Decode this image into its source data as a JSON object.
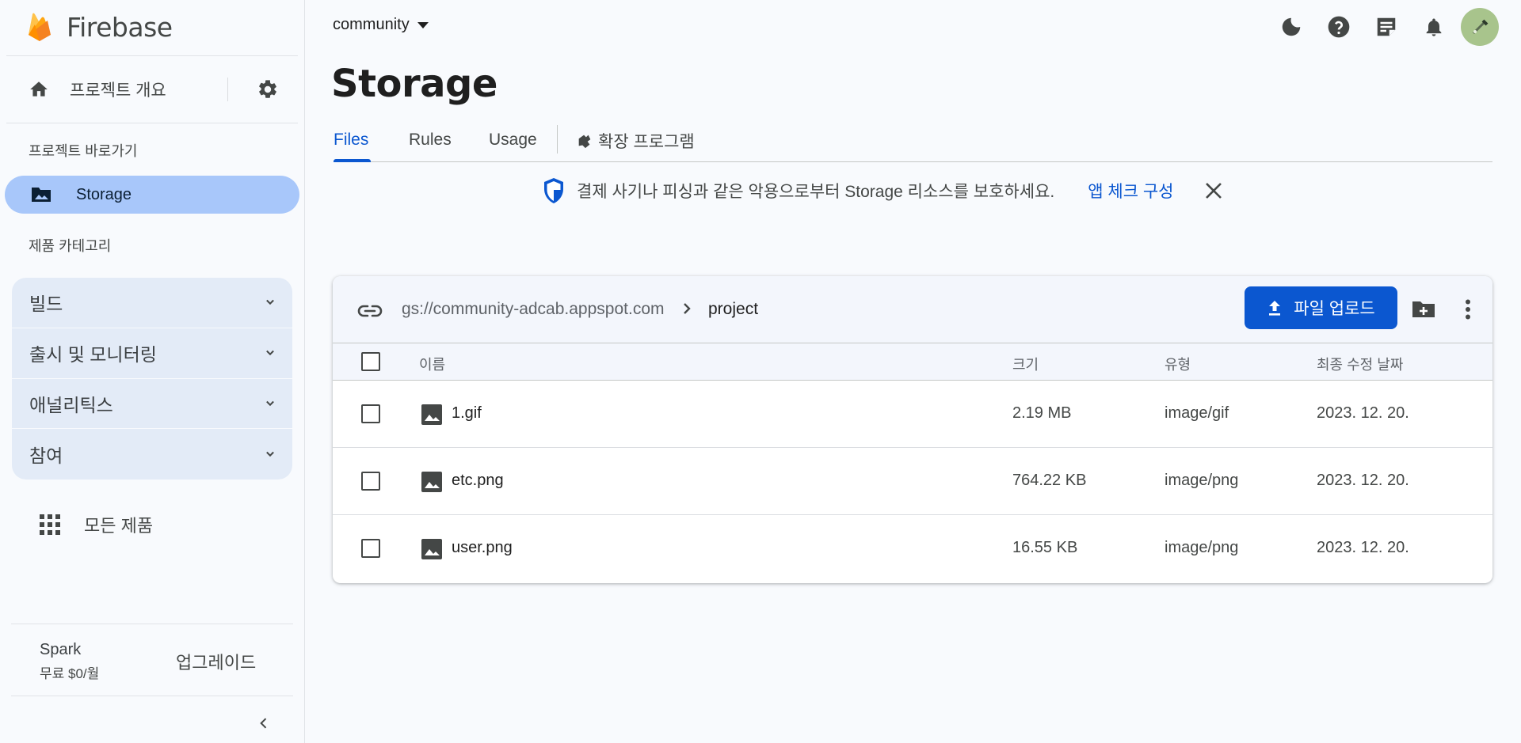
{
  "app": {
    "brand": "Firebase"
  },
  "sidebar": {
    "overview_label": "프로젝트 개요",
    "shortcuts_heading": "프로젝트 바로가기",
    "storage_label": "Storage",
    "categories_heading": "제품 카테고리",
    "categories": [
      {
        "label": "빌드"
      },
      {
        "label": "출시 및 모니터링"
      },
      {
        "label": "애널리틱스"
      },
      {
        "label": "참여"
      }
    ],
    "all_products_label": "모든 제품",
    "plan": {
      "name": "Spark",
      "price": "무료 $0/월",
      "upgrade_label": "업그레이드"
    }
  },
  "header": {
    "project_name": "community"
  },
  "page": {
    "title": "Storage",
    "tabs": [
      {
        "label": "Files",
        "active": true
      },
      {
        "label": "Rules",
        "active": false
      },
      {
        "label": "Usage",
        "active": false
      },
      {
        "label": "확장 프로그램",
        "active": false
      }
    ],
    "banner": {
      "text": "결제 사기나 피싱과 같은 악용으로부터 Storage 리소스를 보호하세요.",
      "link": "앱 체크 구성"
    }
  },
  "files": {
    "bucket": "gs://community-adcab.appspot.com",
    "folder": "project",
    "upload_label": "파일 업로드",
    "columns": {
      "name": "이름",
      "size": "크기",
      "type": "유형",
      "modified": "최종 수정 날짜"
    },
    "rows": [
      {
        "name": "1.gif",
        "size": "2.19 MB",
        "type": "image/gif",
        "modified": "2023. 12. 20."
      },
      {
        "name": "etc.png",
        "size": "764.22 KB",
        "type": "image/png",
        "modified": "2023. 12. 20."
      },
      {
        "name": "user.png",
        "size": "16.55 KB",
        "type": "image/png",
        "modified": "2023. 12. 20."
      }
    ]
  },
  "colors": {
    "accent": "#0b57d0",
    "nav_selected": "#a8c7fa",
    "category_bg": "#e3ebf7",
    "firebase_orange": "#ffa000"
  },
  "icons": {
    "brand": "firebase-flame-icon",
    "overview": "home-icon",
    "settings": "gear-icon",
    "storage": "photo-folder-icon",
    "all_products": "apps-grid-icon",
    "dark_mode": "moon-icon",
    "help": "help-icon",
    "release_notes": "notes-icon",
    "notifications": "bell-icon",
    "banner": "shield-icon",
    "close": "close-icon",
    "copy_link": "link-icon",
    "upload": "upload-icon",
    "new_folder": "create-folder-icon",
    "more": "more-vert-icon",
    "file": "image-file-icon"
  }
}
